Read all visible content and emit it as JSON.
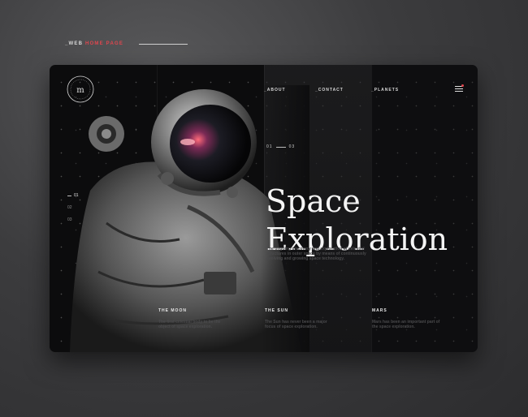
{
  "breadcrumb": {
    "prefix": "_WEB",
    "highlight": "HOME PAGE"
  },
  "nav": {
    "items": [
      "_ABOUT",
      "_CONTACT",
      "_PLANETS"
    ]
  },
  "logo": {
    "monogram": "m",
    "ring_text": "EXPLORE SPACE"
  },
  "counter": {
    "current": "01",
    "total": "03"
  },
  "hero": {
    "title_line1": "Space",
    "title_line2": "Exploration",
    "description": "The ongoing discovery and exploration of celestial structures in outer space by means of continuously evolving and growing space technology."
  },
  "pager": {
    "items": [
      "01",
      "02",
      "03"
    ],
    "active_index": 0
  },
  "features": [
    {
      "heading": "THE MOON",
      "text": "The first celestial body to be the object of space exploration."
    },
    {
      "heading": "THE SUN",
      "text": "The Sun has never been a major focus of space exploration."
    },
    {
      "heading": "MARS",
      "text": "Mars has been an important part of the space exploration."
    }
  ],
  "colors": {
    "accent": "#e0464e",
    "background": "#0c0c0d",
    "text": "#f4f4f4"
  }
}
